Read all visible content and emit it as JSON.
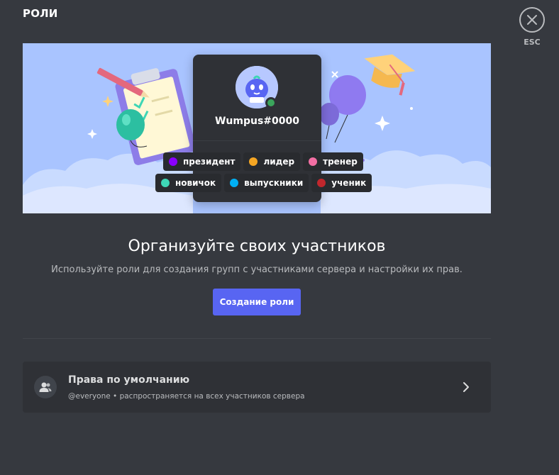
{
  "header": {
    "title": "РОЛИ"
  },
  "close": {
    "esc_label": "ESC"
  },
  "hero": {
    "card": {
      "username": "Wumpus#0000",
      "status_color": "#3ba55c"
    },
    "roles_row1": [
      {
        "label": "президент",
        "color": "#8b00ff"
      },
      {
        "label": "лидер",
        "color": "#f5a623"
      },
      {
        "label": "тренер",
        "color": "#f36fa4"
      }
    ],
    "roles_row2": [
      {
        "label": "новичок",
        "color": "#3ed6b5"
      },
      {
        "label": "выпускники",
        "color": "#00b0f4"
      },
      {
        "label": "ученик",
        "color": "#c1272d"
      }
    ]
  },
  "main": {
    "headline": "Организуйте своих участников",
    "subtext": "Используйте роли для создания групп с участниками сервера и настройки их прав.",
    "create_button": "Создание роли"
  },
  "default_permissions": {
    "title": "Права по умолчанию",
    "description": "@everyone • распространяется на всех участников сервера"
  },
  "colors": {
    "background": "#36393f",
    "accent": "#5865f2",
    "hero": "#a9c4ff"
  }
}
